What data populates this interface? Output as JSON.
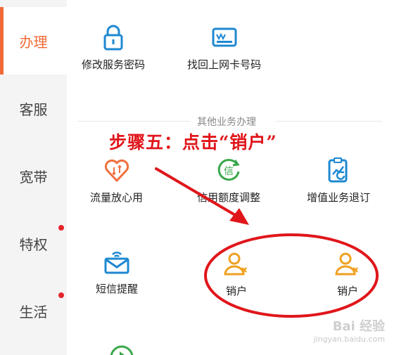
{
  "sidebar": {
    "items": [
      {
        "label": "办理",
        "active": true,
        "dot": false
      },
      {
        "label": "客服",
        "active": false,
        "dot": false
      },
      {
        "label": "宽带",
        "active": false,
        "dot": false
      },
      {
        "label": "特权",
        "active": false,
        "dot": true
      },
      {
        "label": "生活",
        "active": false,
        "dot": true
      }
    ]
  },
  "services": {
    "change_password": "修改服务密码",
    "find_card": "找回上网卡号码"
  },
  "other_section": {
    "title": "其他业务办理",
    "traffic": "流量放心用",
    "credit": "信用额度调整",
    "vas_cancel": "增值业务退订",
    "sms_remind": "短信提醒",
    "cancel_1": "销户",
    "cancel_2": "销户"
  },
  "annotation": {
    "step_text": "步骤五：点击“销户”",
    "color": "#e0161b"
  },
  "watermark": {
    "brand": "Bai 经验",
    "url": "jingyan.baidu.com"
  },
  "colors": {
    "accent": "#f06a35",
    "icon_blue": "#1e88d2",
    "icon_orange": "#f0a020",
    "icon_green": "#3aa74a"
  }
}
